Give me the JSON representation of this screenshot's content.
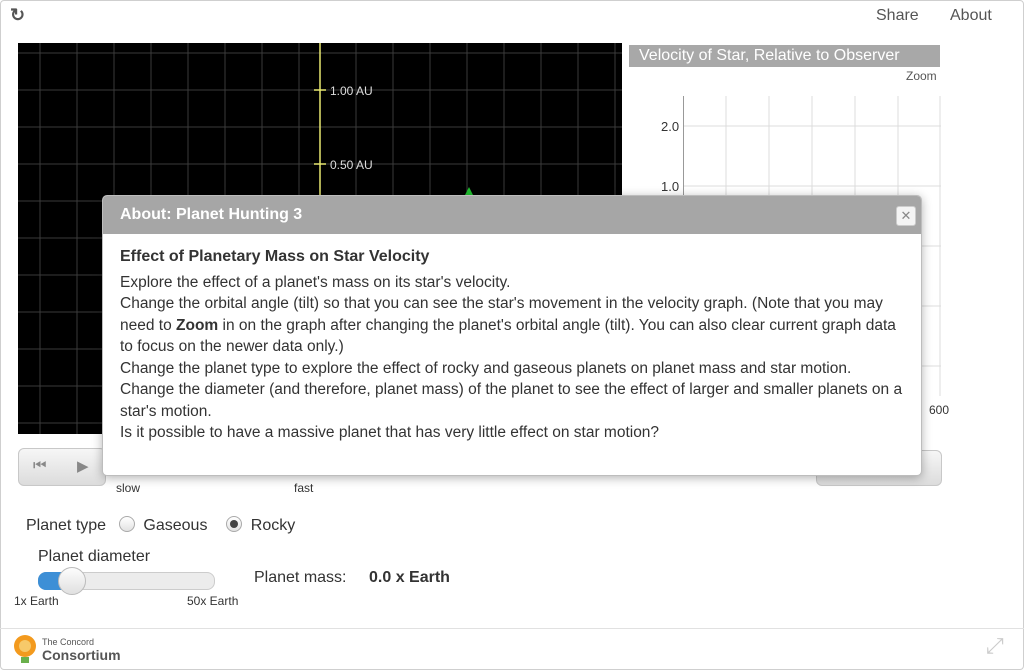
{
  "topbar": {
    "share_label": "Share",
    "about_label": "About",
    "reload_icon": "reload-icon"
  },
  "simulation": {
    "au_labels": [
      "1.00 AU",
      "0.50 AU"
    ]
  },
  "graph": {
    "title": "Velocity of Star, Relative to Observer",
    "zoom_label": "Zoom",
    "y_ticks": [
      "2.0",
      "1.0"
    ],
    "x_tick_right": "600"
  },
  "speed": {
    "slow_label": "slow",
    "fast_label": "fast"
  },
  "planet_type": {
    "label": "Planet type",
    "options": [
      "Gaseous",
      "Rocky"
    ],
    "selected": "Rocky"
  },
  "planet_diameter": {
    "label": "Planet diameter",
    "min_label": "1x Earth",
    "max_label": "50x Earth",
    "value_fraction": 0.12
  },
  "planet_mass": {
    "label": "Planet mass:",
    "value": "0.0 x Earth"
  },
  "footer": {
    "logo_line1": "The Concord",
    "logo_line2": "Consortium"
  },
  "modal": {
    "title": "About: Planet Hunting 3",
    "heading": "Effect of Planetary Mass on Star Velocity",
    "p1": "Explore the effect of a planet's mass on its star's velocity.",
    "p2_pre": "Change the orbital angle (tilt) so that you can see the star's movement in the velocity graph. (Note that you may need to ",
    "p2_bold": "Zoom",
    "p2_post": " in on the graph after changing the planet's orbital angle (tilt). You can also clear current graph data to focus on the newer data only.)",
    "p3": "Change the planet type to explore the effect of rocky and gaseous planets on planet mass and star motion.",
    "p4": "Change the diameter (and therefore, planet mass) of the planet to see the effect of larger and smaller planets on a star's motion.",
    "p5": "Is it possible to have a massive planet that has very little effect on star motion?"
  }
}
